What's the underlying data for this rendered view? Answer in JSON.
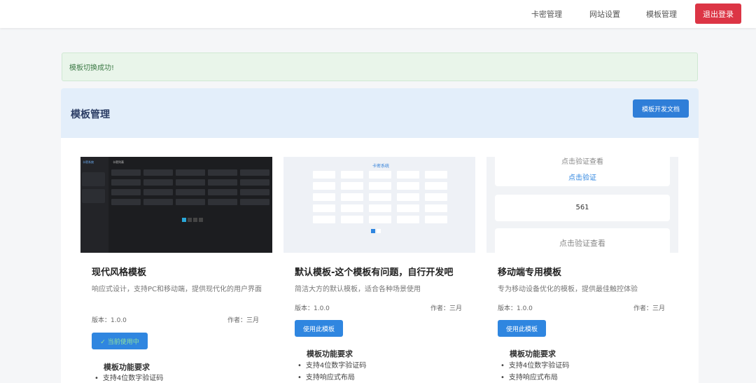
{
  "nav": {
    "links": [
      "卡密管理",
      "网站设置",
      "模板管理"
    ],
    "logout": "退出登录"
  },
  "alert": "模板切换成功!",
  "panel": {
    "title": "模板管理",
    "doc_button": "模板开发文档"
  },
  "previews": {
    "modern": {
      "brand": "卡密系统",
      "heading": "卡密列表"
    },
    "default": {
      "title": "卡密系统"
    },
    "mobile": {
      "top": "点击验证查看",
      "verify_link": "点击验证",
      "code": "561",
      "bottom": "点击验证查看"
    }
  },
  "cards": [
    {
      "title": "现代风格模板",
      "desc": "响应式设计，支持PC和移动端，提供现代化的用户界面",
      "version": "版本：1.0.0",
      "author": "作者：三月",
      "button": "✓ 当前使用中",
      "req_title": "模板功能要求",
      "reqs": [
        "支持4位数字验证码"
      ]
    },
    {
      "title": "默认模板-这个模板有问题，自行开发吧",
      "desc": "简洁大方的默认模板，适合各种场景使用",
      "version": "版本：1.0.0",
      "author": "作者：三月",
      "button": "使用此模板",
      "req_title": "模板功能要求",
      "reqs": [
        "支持4位数字验证码",
        "支持响应式布局"
      ]
    },
    {
      "title": "移动端专用模板",
      "desc": "专为移动设备优化的模板，提供最佳触控体验",
      "version": "版本：1.0.0",
      "author": "作者：三月",
      "button": "使用此模板",
      "req_title": "模板功能要求",
      "reqs": [
        "支持4位数字验证码",
        "支持响应式布局"
      ]
    }
  ],
  "colors": {
    "primary": "#2f86e0",
    "danger": "#dc3545",
    "success_bg": "#e9f5ea",
    "header_bg": "#e3eefa"
  }
}
